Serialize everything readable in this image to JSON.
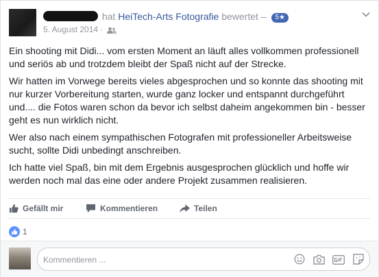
{
  "post": {
    "verb_prefix": "hat",
    "page_name": "HeiTech-Arts Fotografie",
    "verb_suffix": "bewertet –",
    "rating_badge": "5★",
    "date": "5. August 2014 ·",
    "paragraphs": [
      "Ein shooting mit Didi... vom ersten Moment an läuft alles vollkommen professionell und seriös ab und trotzdem bleibt der Spaß nicht auf der Strecke.",
      "Wir hatten im Vorwege bereits vieles abgesprochen und so konnte das shooting mit nur kurzer Vorbereitung starten, wurde ganz locker und entspannt durchgeführt und.... die Fotos waren schon da bevor ich selbst daheim angekommen bin - besser geht es nun wirklich nicht.",
      "Wer also nach einem sympathischen Fotografen mit professioneller Arbeitsweise sucht, sollte Didi unbedingt anschreiben.",
      "Ich hatte viel Spaß, bin mit dem Ergebnis ausgesprochen glücklich und hoffe wir werden noch mal das eine oder andere Projekt zusammen realisieren."
    ]
  },
  "actions": {
    "like": "Gefällt mir",
    "comment": "Kommentieren",
    "share": "Teilen"
  },
  "reactions": {
    "count": "1"
  },
  "comment_box": {
    "placeholder": "Kommentieren ..."
  },
  "icons": [
    "audience-friends-icon",
    "chevron-down-icon",
    "like-icon",
    "comment-icon",
    "share-icon",
    "like-reaction-icon",
    "emoji-icon",
    "camera-icon",
    "gif-icon",
    "sticker-icon"
  ],
  "colors": {
    "link": "#365899",
    "badge": "#4267b2",
    "reaction": "#5890ff"
  }
}
